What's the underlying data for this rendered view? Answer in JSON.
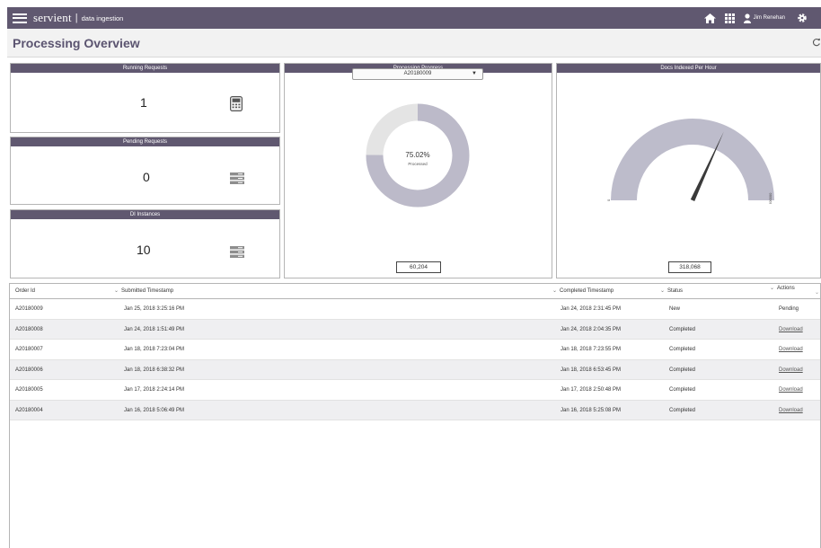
{
  "header": {
    "brand": "servient",
    "separator": "|",
    "subtitle": "data ingestion",
    "user_name": "Jim Renehan"
  },
  "page": {
    "title": "Processing Overview"
  },
  "panels": {
    "running": {
      "title": "Running Requests",
      "value": "1",
      "icon": "calculator-icon"
    },
    "pending": {
      "title": "Pending Requests",
      "value": "0",
      "icon": "server-stack-icon"
    },
    "instances": {
      "title": "DI Instances",
      "value": "10",
      "icon": "server-stack-icon"
    },
    "progress": {
      "title": "Processing Progress",
      "selected_order": "A20180009",
      "percent_label": "75.02%",
      "percent_value": 75.02,
      "sub_label": "Processed",
      "count": "60,204"
    },
    "docs_per_hour": {
      "title": "Docs Indexed Per Hour",
      "min_label": "0",
      "max_label": "500000",
      "value": "318,068",
      "needle_fraction": 0.636
    }
  },
  "table": {
    "headers": {
      "order_id": "Order Id",
      "submitted": "Submitted Timestamp",
      "completed": "Completed Timestamp",
      "status": "Status",
      "actions": "Actions"
    },
    "rows": [
      {
        "order_id": "A20180009",
        "submitted": "Jan 25, 2018 3:25:16 PM",
        "completed": "Jan 24, 2018 2:31:45 PM",
        "status": "New",
        "action": "Pending"
      },
      {
        "order_id": "A20180008",
        "submitted": "Jan 24, 2018 1:51:49 PM",
        "completed": "Jan 24, 2018 2:04:35 PM",
        "status": "Completed",
        "action": "Download"
      },
      {
        "order_id": "A20180007",
        "submitted": "Jan 18, 2018 7:23:04 PM",
        "completed": "Jan 18, 2018 7:23:55 PM",
        "status": "Completed",
        "action": "Download"
      },
      {
        "order_id": "A20180006",
        "submitted": "Jan 18, 2018 6:38:32 PM",
        "completed": "Jan 18, 2018 6:53:45 PM",
        "status": "Completed",
        "action": "Download"
      },
      {
        "order_id": "A20180005",
        "submitted": "Jan 17, 2018 2:24:14 PM",
        "completed": "Jan 17, 2018 2:50:48 PM",
        "status": "Completed",
        "action": "Download"
      },
      {
        "order_id": "A20180004",
        "submitted": "Jan 16, 2018 5:06:49 PM",
        "completed": "Jan 16, 2018 5:25:08 PM",
        "status": "Completed",
        "action": "Download"
      }
    ]
  },
  "colors": {
    "header_bg": "#605870",
    "donut_fill": "#bcbac9",
    "donut_rest": "#e4e4e4",
    "gauge_fill": "#bdbccb",
    "needle": "#3a3a3a"
  }
}
